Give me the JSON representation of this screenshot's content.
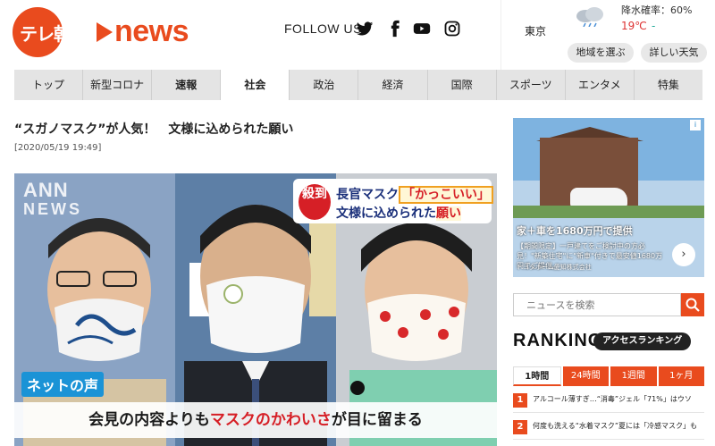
{
  "header": {
    "logo_jp": "テレ朝",
    "logo_news": "news",
    "follow_label": "FOLLOW US"
  },
  "weather": {
    "city": "東京",
    "precip_label": "降水確率：60%",
    "temperature": "19℃",
    "temp_secondary": "-",
    "btn_region": "地域を選ぶ",
    "btn_details": "詳しい天気"
  },
  "nav": {
    "items": [
      "トップ",
      "新型コロナ",
      "速報",
      "社会",
      "政治",
      "経済",
      "国際",
      "スポーツ",
      "エンタメ",
      "特集"
    ],
    "active": "社会"
  },
  "article": {
    "headline": "“スガノマスク”が人気！　文様に込められた願い",
    "date": "[2020/05/19 19:49]",
    "photo": {
      "watermark_top": "ANN",
      "watermark_bottom": "NEWS",
      "badge": "殺到",
      "caption_line1_pre": "長官マスク",
      "caption_line1_hl": "「かっこいい」",
      "caption_line2_pre": "文様に込められた",
      "caption_line2_hl": "願い",
      "net_voice": "ネットの声",
      "subtitle_pre": "会見の内容よりも",
      "subtitle_red": "マスクのかわいさ",
      "subtitle_post": "が目に留まる"
    }
  },
  "ad": {
    "title": "家＋車を1680万円で提供",
    "body": "【期間限定】一戸建てをご検討中の方必見！\"新築住宅\"に\"新車\"付きで最安値1680万円でご提供。",
    "sponsor": "トヨタホーム愛知株式会社",
    "next_glyph": "›",
    "badge_glyph": "i"
  },
  "search": {
    "placeholder": "ニュースを検索"
  },
  "ranking": {
    "title": "RANKING",
    "pill": "アクセスランキング",
    "tabs": [
      "1時間",
      "24時間",
      "1週間",
      "1ヶ月"
    ],
    "active_tab": "1時間",
    "items": [
      {
        "num": "1",
        "text": "アルコール薄すぎ…“消毒”ジェル「71%」はウソ"
      },
      {
        "num": "2",
        "text": "何度も洗える“水着マスク”夏には「冷感マスク」も"
      }
    ]
  },
  "colors": {
    "brand": "#e94b1e",
    "nav_bg": "#e4e4e4",
    "caption_red": "#d61f26",
    "caption_blue": "#1a2f7a"
  }
}
